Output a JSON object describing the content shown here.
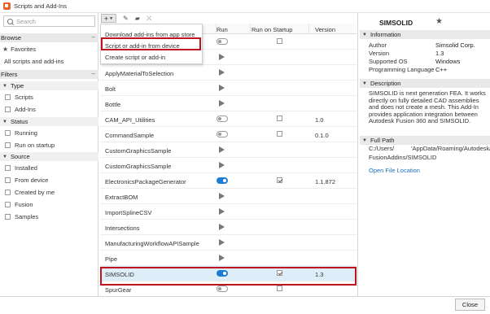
{
  "window": {
    "title": "Scripts and Add-Ins"
  },
  "search": {
    "placeholder": "Search"
  },
  "sidebar": {
    "browse_label": "Browse",
    "favorites_label": "Favorites",
    "all_label": "All scripts and add-ins",
    "filters_label": "Filters",
    "type_label": "Type",
    "type_items": [
      "Scripts",
      "Add-Ins"
    ],
    "status_label": "Status",
    "status_items": [
      "Running",
      "Run on startup"
    ],
    "source_label": "Source",
    "source_items": [
      "Installed",
      "From device",
      "Created by me",
      "Fusion",
      "Samples"
    ]
  },
  "menu": {
    "items": [
      "Download add-ins from app store",
      "Script or add-in from device",
      "Create script or add-in"
    ]
  },
  "table": {
    "headers": {
      "run": "Run",
      "startup": "Run on Startup",
      "version": "Version"
    },
    "rows": [
      {
        "name": "",
        "run": "toggle",
        "run_on": false,
        "startup": "unchecked",
        "version": ""
      },
      {
        "name": "",
        "run": "play",
        "startup": "",
        "version": ""
      },
      {
        "name": "ApplyMaterialToSelection",
        "run": "play",
        "startup": "",
        "version": ""
      },
      {
        "name": "Bolt",
        "run": "play",
        "startup": "",
        "version": ""
      },
      {
        "name": "Bottle",
        "run": "play",
        "startup": "",
        "version": ""
      },
      {
        "name": "CAM_API_Utilities",
        "run": "toggle",
        "run_on": false,
        "startup": "unchecked",
        "version": "1.0"
      },
      {
        "name": "CommandSample",
        "run": "toggle",
        "run_on": false,
        "startup": "unchecked",
        "version": "0.1.0"
      },
      {
        "name": "CustomGraphicsSample",
        "run": "play",
        "startup": "",
        "version": ""
      },
      {
        "name": "CustomGraphicsSample",
        "run": "play",
        "startup": "",
        "version": ""
      },
      {
        "name": "ElectronicsPackageGenerator",
        "run": "toggle",
        "run_on": true,
        "startup": "checked",
        "version": "1.1.872"
      },
      {
        "name": "ExtractBOM",
        "run": "play",
        "startup": "",
        "version": ""
      },
      {
        "name": "ImportSplineCSV",
        "run": "play",
        "startup": "",
        "version": ""
      },
      {
        "name": "Intersections",
        "run": "play",
        "startup": "",
        "version": ""
      },
      {
        "name": "ManufacturingWorkflowAPISample",
        "run": "play",
        "startup": "",
        "version": ""
      },
      {
        "name": "Pipe",
        "run": "play",
        "startup": "",
        "version": ""
      },
      {
        "name": "SIMSOLID",
        "run": "toggle",
        "run_on": true,
        "startup": "checked",
        "version": "1.3"
      },
      {
        "name": "SpurGear",
        "run": "toggle",
        "run_on": false,
        "startup": "unchecked",
        "version": ""
      }
    ]
  },
  "details": {
    "title": "SIMSOLID",
    "info_label": "Information",
    "info": [
      {
        "key": "Author",
        "value": "Simsolid Corp."
      },
      {
        "key": "Version",
        "value": "1.3"
      },
      {
        "key": "Supported OS",
        "value": "Windows"
      },
      {
        "key": "Programming Language",
        "value": "C++"
      }
    ],
    "description_label": "Description",
    "description": "SIMSOLID is next generation FEA. It works directly on fully detailed CAD assemblies and does not create a mesh. This Add-In provides application integration between Autodesk Fusion 360 and SIMSOLID.",
    "path_label": "Full Path",
    "path_line1": "C:/Users/          'AppData/Roaming/Autodesk/",
    "path_line2": "FusionAddins/SIMSOLID",
    "open_location": "Open File Location"
  },
  "footer": {
    "close_label": "Close"
  },
  "colors": {
    "accent": "#1f7bd3",
    "highlight": "#c1121f",
    "selected_row": "#ddeef9"
  }
}
